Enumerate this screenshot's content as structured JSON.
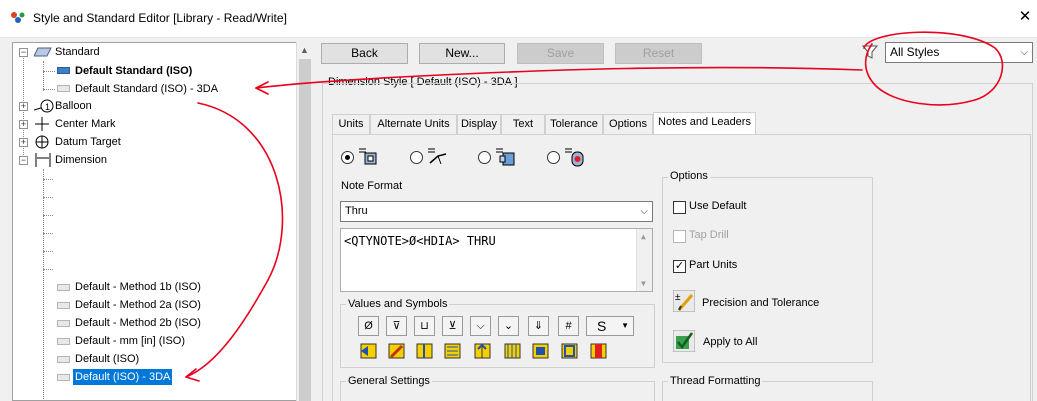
{
  "window": {
    "title": "Style and Standard Editor [Library - Read/Write]",
    "close_glyph": "✕"
  },
  "tree": {
    "nodes": [
      {
        "label": "Standard",
        "icon": "standard-icon",
        "expanded": true
      },
      {
        "label": "Default Standard (ISO)",
        "bold": true
      },
      {
        "label": "Default Standard (ISO) - 3DA"
      },
      {
        "label": "Balloon",
        "icon": "balloon-icon",
        "expanded": false
      },
      {
        "label": "Center Mark",
        "icon": "center-mark-icon",
        "expanded": false
      },
      {
        "label": "Datum Target",
        "icon": "datum-target-icon",
        "expanded": false
      },
      {
        "label": "Dimension",
        "icon": "dimension-icon",
        "expanded": true
      },
      {
        "label": "Default - Method 1b (ISO)"
      },
      {
        "label": "Default - Method 2a (ISO)"
      },
      {
        "label": "Default - Method 2b (ISO)"
      },
      {
        "label": "Default - mm [in] (ISO)"
      },
      {
        "label": "Default (ISO)"
      },
      {
        "label": "Default (ISO) - 3DA",
        "selected": true
      }
    ]
  },
  "toolbar": {
    "back_label": "Back",
    "new_label": "New...",
    "save_label": "Save",
    "reset_label": "Reset",
    "filter_value": "All Styles"
  },
  "dimension_style": {
    "group_title": "Dimension Style [ Default (ISO) - 3DA ]",
    "tabs": [
      "Units",
      "Alternate Units",
      "Display",
      "Text",
      "Tolerance",
      "Options",
      "Notes and Leaders"
    ],
    "active_tab": "Notes and Leaders"
  },
  "note_format": {
    "label": "Note Format",
    "selected_type": "Thru",
    "text": "<QTYNOTE>Ø<HDIA> THRU"
  },
  "values_and_symbols": {
    "label": "Values and Symbols",
    "row1": [
      "Ø",
      "⊽",
      "⊔",
      "⊻",
      "⌵",
      "⌄",
      "⇓",
      "#"
    ],
    "dropdown_symbol": "S"
  },
  "options": {
    "label": "Options",
    "use_default": "Use Default",
    "tap_drill": "Tap Drill",
    "part_units": "Part Units",
    "precision": "Precision and Tolerance",
    "apply_all": "Apply to All"
  },
  "general_settings_label": "General Settings",
  "thread_formatting_label": "Thread Formatting",
  "colors": {
    "selection": "#0078d7",
    "annotation": "#e8001c"
  }
}
